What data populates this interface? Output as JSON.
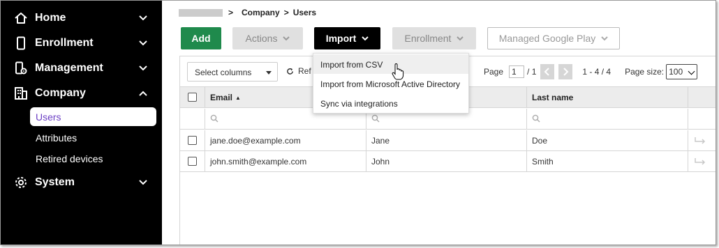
{
  "sidebar": {
    "items": [
      {
        "label": "Home",
        "icon": "home-icon"
      },
      {
        "label": "Enrollment",
        "icon": "phone-icon"
      },
      {
        "label": "Management",
        "icon": "device-gear-icon"
      },
      {
        "label": "Company",
        "icon": "building-icon",
        "expanded": true
      },
      {
        "label": "System",
        "icon": "gear-icon"
      }
    ],
    "company_sub": [
      {
        "label": "Users",
        "active": true
      },
      {
        "label": "Attributes"
      },
      {
        "label": "Retired devices"
      }
    ]
  },
  "breadcrumb": {
    "sep1": ">",
    "company": "Company",
    "sep2": ">",
    "users": "Users"
  },
  "toolbar": {
    "add": "Add",
    "actions": "Actions",
    "import": "Import",
    "enrollment": "Enrollment",
    "google_play": "Managed Google Play"
  },
  "grid_toolbar": {
    "select_columns": "Select columns",
    "refresh": "Ref",
    "page_label": "Page",
    "page_value": "1",
    "page_total": "/ 1",
    "range": "1 - 4 / 4",
    "page_size_label": "Page size:",
    "page_size_value": "100"
  },
  "columns": {
    "email": "Email",
    "sort_indicator": "▲",
    "last_name": "Last name"
  },
  "rows": [
    {
      "email": "jane.doe@example.com",
      "first_name": "Jane",
      "last_name": "Doe"
    },
    {
      "email": "john.smith@example.com",
      "first_name": "John",
      "last_name": "Smith"
    }
  ],
  "import_menu": [
    {
      "label": "Import from CSV",
      "hover": true
    },
    {
      "label": "Import from Microsoft Active Directory"
    },
    {
      "label": "Sync via integrations"
    }
  ],
  "colors": {
    "add_green": "#1f8a4c",
    "active_purple": "#6b3fc4",
    "sidebar_bg": "#000000"
  }
}
